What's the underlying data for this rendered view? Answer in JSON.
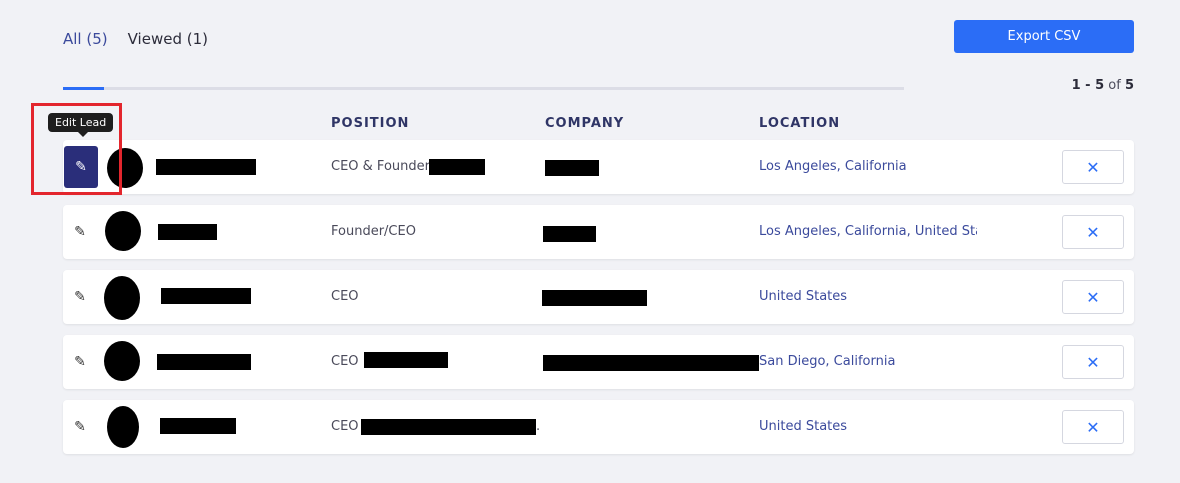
{
  "tabs": [
    {
      "label": "All (5)",
      "active": true
    },
    {
      "label": "Viewed (1)",
      "active": false
    }
  ],
  "export_label": "Export CSV",
  "pagination": {
    "range": "1 - 5",
    "of_label": "of",
    "total": "5"
  },
  "columns": {
    "position": "POSITION",
    "company": "COMPANY",
    "location": "LOCATION"
  },
  "tooltip": "Edit Lead",
  "icons": {
    "edit": "pencil-icon",
    "remove": "close-icon"
  },
  "colors": {
    "accent": "#2b6df6",
    "active_edit": "#2a2e7a",
    "highlight": "#e3262d"
  },
  "rows": [
    {
      "position": "CEO & Founder",
      "location": "Los Angeles, California"
    },
    {
      "position": "Founder/CEO",
      "location": "Los Angeles, California, United Stat"
    },
    {
      "position": "CEO",
      "location": "United States"
    },
    {
      "position": "CEO",
      "location": "San Diego, California"
    },
    {
      "position": "CEO",
      "location": "United States"
    }
  ],
  "row5_company_suffix": "."
}
